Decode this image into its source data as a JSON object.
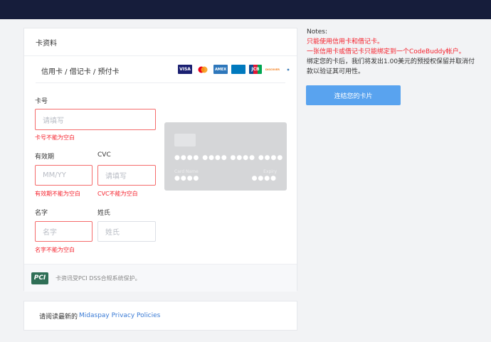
{
  "card_section": {
    "header": "卡资料",
    "card_types": "信用卡 / 借记卡 / 预付卡",
    "logos": [
      "VISA",
      "mastercard",
      "AMEX",
      "Diners Club",
      "JCB",
      "DISCOVER",
      "UnionPay"
    ],
    "card_number": {
      "label": "卡号",
      "placeholder": "请填写",
      "error": "卡号不能为空白"
    },
    "expiry": {
      "label": "有效期",
      "placeholder": "MM/YY",
      "error": "有效期不能为空白"
    },
    "cvc": {
      "label": "CVC",
      "placeholder": "请填写",
      "error": "CVC不能为空白"
    },
    "first_name": {
      "label": "名字",
      "placeholder": "名字",
      "error": "名字不能为空白"
    },
    "last_name": {
      "label": "姓氏",
      "placeholder": "姓氏"
    },
    "preview": {
      "dots": "●●●●  ●●●●  ●●●●  ●●●●",
      "name_label": "Card Name",
      "expiry_label": "Expiry",
      "name_dots": "●●●●",
      "expiry_dots": "●●●●"
    },
    "pci_logo": "PCI",
    "pci_text": "卡资讯受PCI DSS合规系统保护。"
  },
  "privacy": {
    "prefix": "请阅读最新的",
    "link": "Midaspay Privacy Policies"
  },
  "notes": {
    "title": "Notes:",
    "line1": "只能使用信用卡和借记卡。",
    "line2": "一张信用卡或借记卡只能绑定到一个CodeBuddy帐户。",
    "line3": "绑定您的卡后，我们将发出1.00美元的预授权保留并取消付款以验证其可用性。"
  },
  "link_button": "连结您的卡片",
  "colors": {
    "topbar": "#161d3b",
    "error": "#f5222d",
    "button": "#59a3ef",
    "link": "#3a7bd5"
  }
}
